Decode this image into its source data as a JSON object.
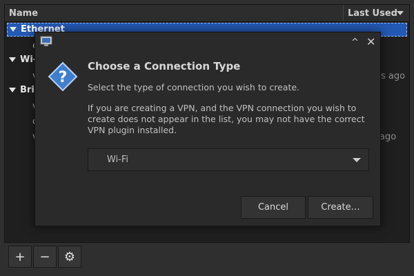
{
  "list": {
    "header": {
      "name": "Name",
      "last_used": "Last Used"
    },
    "groups": [
      {
        "label": "Ethernet"
      },
      {
        "label": "Wi-"
      },
      {
        "label": "Brid"
      }
    ],
    "children": [
      "e",
      "v",
      "v",
      "c",
      "v"
    ],
    "last_used": [
      "es ago",
      "ago"
    ]
  },
  "toolbar": {
    "add": "+",
    "remove": "−",
    "settings": "⚙"
  },
  "dialog": {
    "title": "Choose a Connection Type",
    "subtitle": "Select the type of connection you wish to create.",
    "body": "If you are creating a VPN, and the VPN connection you wish to create does not appear in the list, you may not have the correct VPN plugin installed.",
    "combo_value": "Wi-Fi",
    "cancel_label": "Cancel",
    "create_label": "Create…",
    "minmax_glyph": "^",
    "close_glyph": "✕"
  },
  "colors": {
    "selection": "#2459b3",
    "dialog_bg": "#2a2a2a",
    "question_icon": "#3d7ecf"
  }
}
